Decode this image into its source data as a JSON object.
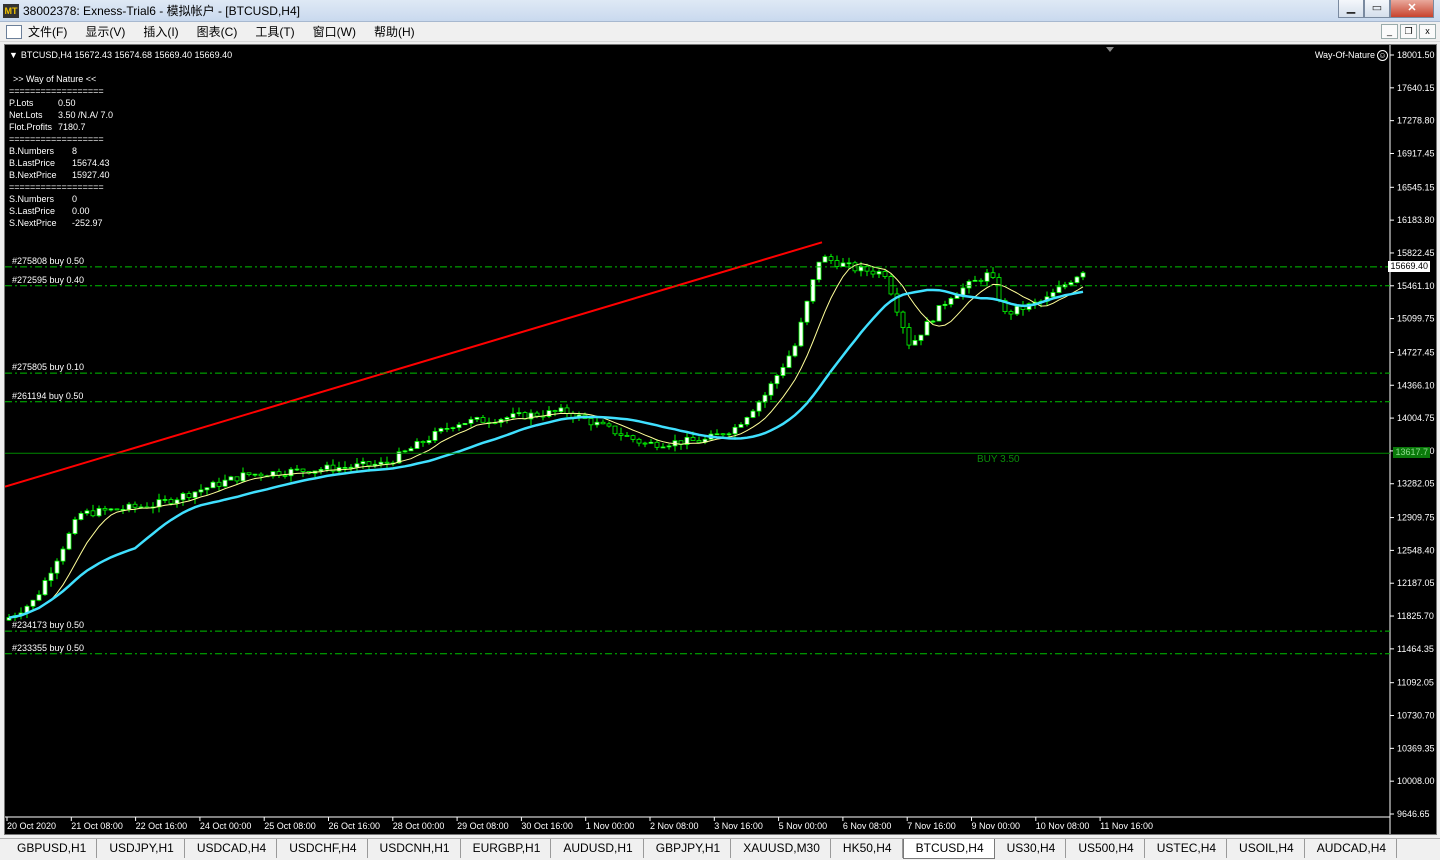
{
  "window": {
    "title": "38002378: Exness-Trial6 - 模拟帐户 - [BTCUSD,H4]",
    "app_icon": "mt-logo-icon",
    "buttons": {
      "minimize": "▁",
      "maximize": "▭",
      "close": "✕"
    }
  },
  "menu": {
    "items": [
      "文件(F)",
      "显示(V)",
      "插入(I)",
      "图表(C)",
      "工具(T)",
      "窗口(W)",
      "帮助(H)"
    ],
    "mdi_buttons": {
      "minimize": "_",
      "restore": "❐",
      "close": "x"
    }
  },
  "chart": {
    "header": "BTCUSD,H4  15672.43 15674.68 15669.40 15669.40",
    "expert": "Way-Of-Nature",
    "panel": {
      "title": ">> Way of Nature <<",
      "separator": "==================",
      "rows1": [
        [
          "P.Lots",
          "0.50"
        ],
        [
          "Net.Lots",
          "3.50  /N.A/  7.0"
        ],
        [
          "Flot.Profits",
          "7180.7"
        ]
      ],
      "rows2": [
        [
          "B.Numbers",
          "8"
        ],
        [
          "B.LastPrice",
          "15674.43"
        ],
        [
          "B.NextPrice",
          "15927.40"
        ]
      ],
      "rows3": [
        [
          "S.Numbers",
          "0"
        ],
        [
          "S.LastPrice",
          "0.00"
        ],
        [
          "S.NextPrice",
          "-252.97"
        ]
      ]
    },
    "order_lines": [
      {
        "label": "#275808 buy 0.50",
        "price": 15669.4
      },
      {
        "label": "#272595 buy 0.40",
        "price": 15461
      },
      {
        "label": "#275805 buy 0.10",
        "price": 14500
      },
      {
        "label": "#261194 buy 0.50",
        "price": 14185
      },
      {
        "label": "#234173 buy 0.50",
        "price": 11660
      },
      {
        "label": "#233355 buy 0.50",
        "price": 11410
      }
    ],
    "avg_line": {
      "label": "BUY  3.50",
      "price": 13617.7
    },
    "price_tags": {
      "current": "15669.40",
      "average": "13617.7"
    },
    "y_axis_ticks": [
      "18001.50",
      "17640.15",
      "17278.80",
      "16917.45",
      "16545.15",
      "16183.80",
      "15822.45",
      "15461.10",
      "15099.75",
      "14727.45",
      "14366.10",
      "14004.75",
      "13643.40",
      "13282.05",
      "12909.75",
      "12548.40",
      "12187.05",
      "11825.70",
      "11464.35",
      "11092.05",
      "10730.70",
      "10369.35",
      "10008.00",
      "9646.65"
    ],
    "x_axis_ticks": [
      "20 Oct 2020",
      "21 Oct 08:00",
      "22 Oct 16:00",
      "24 Oct 00:00",
      "25 Oct 08:00",
      "26 Oct 16:00",
      "28 Oct 00:00",
      "29 Oct 08:00",
      "30 Oct 16:00",
      "1 Nov 00:00",
      "2 Nov 08:00",
      "3 Nov 16:00",
      "5 Nov 00:00",
      "6 Nov 08:00",
      "7 Nov 16:00",
      "9 Nov 00:00",
      "10 Nov 08:00",
      "11 Nov 16:00"
    ],
    "colors": {
      "bg": "#000000",
      "bull": "#ffffff",
      "bear": "#000000",
      "candle_outline": "#00ff00",
      "fast_ma": "#ffff99",
      "slow_ma": "#40e0ff",
      "trend": "#ff0000",
      "order_line": "#00c000",
      "avg_line": "#008800"
    }
  },
  "tabs": {
    "items": [
      "GBPUSD,H1",
      "USDJPY,H1",
      "USDCAD,H4",
      "USDCHF,H4",
      "USDCNH,H1",
      "EURGBP,H1",
      "AUDUSD,H1",
      "GBPJPY,H1",
      "XAUUSD,M30",
      "HK50,H4",
      "BTCUSD,H4",
      "US30,H4",
      "US500,H4",
      "USTEC,H4",
      "USOIL,H4",
      "AUDCAD,H4"
    ],
    "active": "BTCUSD,H4"
  }
}
